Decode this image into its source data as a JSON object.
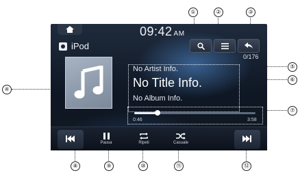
{
  "status_bar": {
    "time": "09:42",
    "ampm": "AM"
  },
  "source": {
    "label": "iPod",
    "icon": "ipod-icon"
  },
  "toolbar": {
    "search_icon": "search-icon",
    "menu_icon": "menu-icon",
    "back_icon": "back-arrow-icon"
  },
  "track": {
    "count": "0/176",
    "artist": "No Artist Info.",
    "title": "No Title Info.",
    "album": "No Album Info.",
    "elapsed": "0:46",
    "total": "3:58",
    "progress": 0.19
  },
  "controls": {
    "prev_icon": "previous-track-icon",
    "pause_label": "Pausa",
    "repeat_label": "Ripeti",
    "shuffle_label": "Casuale",
    "next_icon": "next-track-icon"
  },
  "callouts": {
    "c1": "①",
    "c2": "②",
    "c3": "③",
    "c4": "④",
    "c5": "⑤",
    "c6": "⑥",
    "c7": "⑦",
    "c8": "⑧",
    "c9": "⑨",
    "c10": "⑩",
    "c11": "⑪",
    "c12": "⑫"
  }
}
